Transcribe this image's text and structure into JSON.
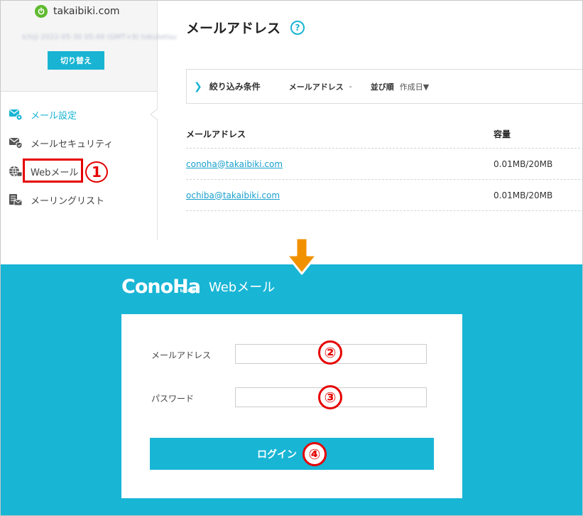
{
  "sidebar": {
    "domain": "takaibiki.com",
    "plan_text": "Ichiji 2022-05-30 05:49 (GMT+9) tokubetsu",
    "switch_label": "切り替え",
    "items": [
      {
        "label": "メール設定",
        "icon": "mail-gear-icon",
        "active": true
      },
      {
        "label": "メールセキュリティ",
        "icon": "mail-shield-icon",
        "active": false
      },
      {
        "label": "Webメール",
        "icon": "globe-icon",
        "active": false
      },
      {
        "label": "メーリングリスト",
        "icon": "mailing-list-icon",
        "active": false
      }
    ]
  },
  "main": {
    "title": "メールアドレス",
    "help": "?",
    "filter": {
      "label": "絞り込み条件",
      "email_key": "メールアドレス",
      "email_val": "-",
      "sort_key": "並び順",
      "sort_val": "作成日▼"
    },
    "table": {
      "headers": [
        "メールアドレス",
        "容量"
      ],
      "rows": [
        {
          "email": "conoha@takaibiki.com",
          "capacity": "0.01MB/20MB"
        },
        {
          "email": "ochiba@takaibiki.com",
          "capacity": "0.01MB/20MB"
        }
      ]
    }
  },
  "login": {
    "logo": "ConoHa",
    "logo_by": "by GMO",
    "title": "Webメール",
    "email_label": "メールアドレス",
    "password_label": "パスワード",
    "email_value": "",
    "password_value": "",
    "button_label": "ログイン"
  },
  "annotations": {
    "step1": "1",
    "step2": "②",
    "step3": "③",
    "step4": "④"
  },
  "colors": {
    "accent": "#19b4d3",
    "callout": "#e60000",
    "arrow": "#f29100",
    "power": "#5fba2e"
  }
}
